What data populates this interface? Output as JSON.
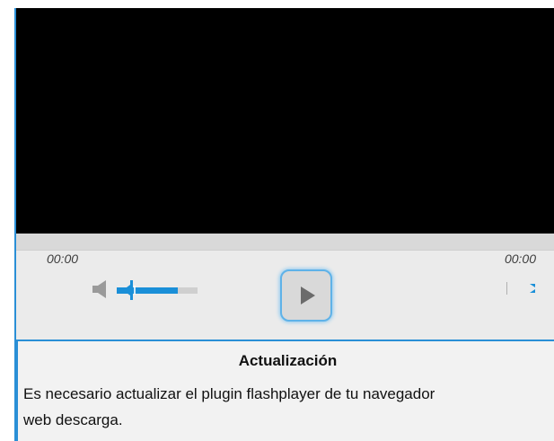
{
  "player": {
    "current_time": "00:00",
    "total_time": "00:00",
    "volume_level_percent": 75,
    "colors": {
      "accent": "#2a8fd6",
      "volume_fill": "#1a8fd8",
      "screen": "#000000",
      "control_bg": "#ebebeb"
    },
    "icons": {
      "volume": "speaker-icon",
      "play": "play-icon",
      "fullscreen": "fullscreen-icon"
    }
  },
  "notice": {
    "title": "Actualización",
    "line1": "Es necesario actualizar el plugin flashplayer de tu navegador",
    "line2": "web descarga."
  }
}
